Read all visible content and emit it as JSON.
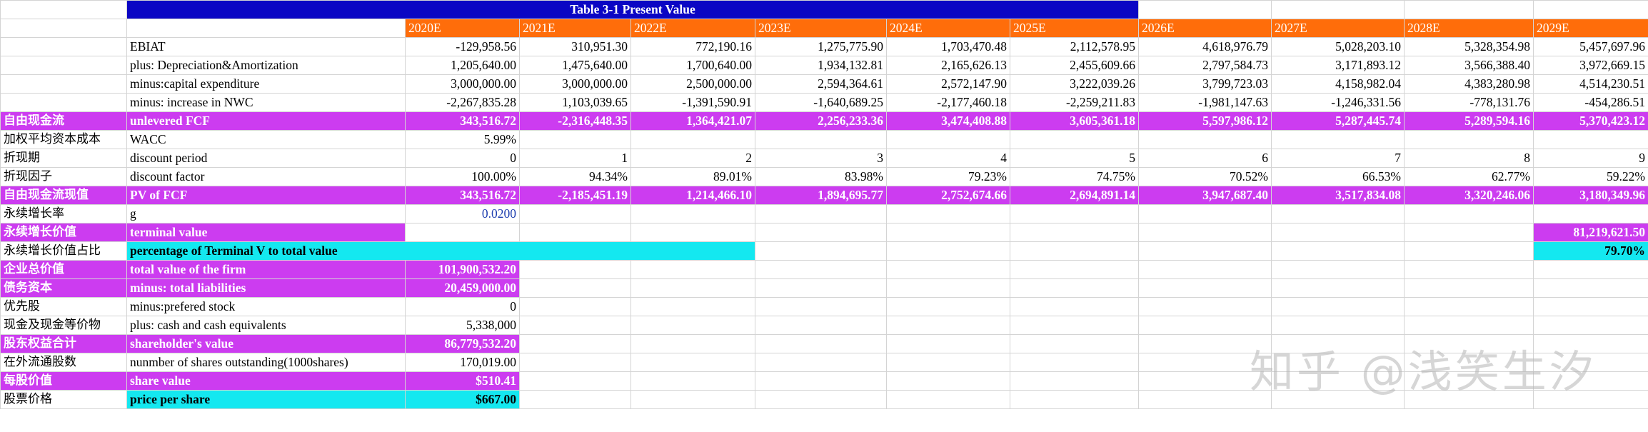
{
  "title": "Table 3-1 Present Value",
  "years": [
    "2020E",
    "2021E",
    "2022E",
    "2023E",
    "2024E",
    "2025E",
    "2026E",
    "2027E",
    "2028E",
    "2029E"
  ],
  "rows": {
    "ebiat": {
      "label": "EBIAT",
      "values": [
        "-129,958.56",
        "310,951.30",
        "772,190.16",
        "1,275,775.90",
        "1,703,470.48",
        "2,112,578.95",
        "4,618,976.79",
        "5,028,203.10",
        "5,328,354.98",
        "5,457,697.96"
      ]
    },
    "da": {
      "label": "plus: Depreciation&Amortization",
      "values": [
        "1,205,640.00",
        "1,475,640.00",
        "1,700,640.00",
        "1,934,132.81",
        "2,165,626.13",
        "2,455,609.66",
        "2,797,584.73",
        "3,171,893.12",
        "3,566,388.40",
        "3,972,669.15"
      ]
    },
    "capex": {
      "label": "minus:capital expenditure",
      "values": [
        "3,000,000.00",
        "3,000,000.00",
        "2,500,000.00",
        "2,594,364.61",
        "2,572,147.90",
        "3,222,039.26",
        "3,799,723.03",
        "4,158,982.04",
        "4,383,280.98",
        "4,514,230.51"
      ]
    },
    "nwc": {
      "label": "minus: increase in NWC",
      "values": [
        "-2,267,835.28",
        "1,103,039.65",
        "-1,391,590.91",
        "-1,640,689.25",
        "-2,177,460.18",
        "-2,259,211.83",
        "-1,981,147.63",
        "-1,246,331.56",
        "-778,131.76",
        "-454,286.51"
      ]
    },
    "fcf": {
      "cn": "自由现金流",
      "label": "unlevered FCF",
      "values": [
        "343,516.72",
        "-2,316,448.35",
        "1,364,421.07",
        "2,256,233.36",
        "3,474,408.88",
        "3,605,361.18",
        "5,597,986.12",
        "5,287,445.74",
        "5,289,594.16",
        "5,370,423.12"
      ]
    },
    "wacc": {
      "cn": "加权平均资本成本",
      "label": "WACC",
      "value": "5.99%"
    },
    "period": {
      "cn": "折现期",
      "label": "discount period",
      "values": [
        "0",
        "1",
        "2",
        "3",
        "4",
        "5",
        "6",
        "7",
        "8",
        "9"
      ]
    },
    "factor": {
      "cn": "折现因子",
      "label": "discount factor",
      "values": [
        "100.00%",
        "94.34%",
        "89.01%",
        "83.98%",
        "79.23%",
        "74.75%",
        "70.52%",
        "66.53%",
        "62.77%",
        "59.22%"
      ]
    },
    "pv": {
      "cn": "自由现金流现值",
      "label": "PV of FCF",
      "values": [
        "343,516.72",
        "-2,185,451.19",
        "1,214,466.10",
        "1,894,695.77",
        "2,752,674.66",
        "2,694,891.14",
        "3,947,687.40",
        "3,517,834.08",
        "3,320,246.06",
        "3,180,349.96"
      ]
    },
    "g": {
      "cn": "永续增长率",
      "label": "g",
      "value": "0.0200"
    },
    "tv": {
      "cn": "永续增长价值",
      "label": "terminal value",
      "value": "81,219,621.50"
    },
    "tvpct": {
      "cn": "永续增长价值占比",
      "label": "percentage of Terminal V to total value",
      "value": "79.70%"
    },
    "firm": {
      "cn": "企业总价值",
      "label": "total value of the firm",
      "value": "101,900,532.20"
    },
    "debt": {
      "cn": "债务资本",
      "label": "minus: total liabilities",
      "value": "20,459,000.00"
    },
    "pref": {
      "cn": "优先股",
      "label": "minus:prefered stock",
      "value": "0"
    },
    "cash": {
      "cn": "现金及现金等价物",
      "label": "plus: cash and cash equivalents",
      "value": "5,338,000"
    },
    "equity": {
      "cn": "股东权益合计",
      "label": "shareholder's value",
      "value": "86,779,532.20"
    },
    "shares": {
      "cn": "在外流通股数",
      "label": "nunmber of shares outstanding(1000shares)",
      "value": "170,019.00"
    },
    "sv": {
      "cn": "每股价值",
      "label": "share value",
      "value": "$510.41"
    },
    "price": {
      "cn": "股票价格",
      "label": "price per share",
      "value": "$667.00"
    }
  },
  "watermark": "知乎 @浅笑生汐"
}
